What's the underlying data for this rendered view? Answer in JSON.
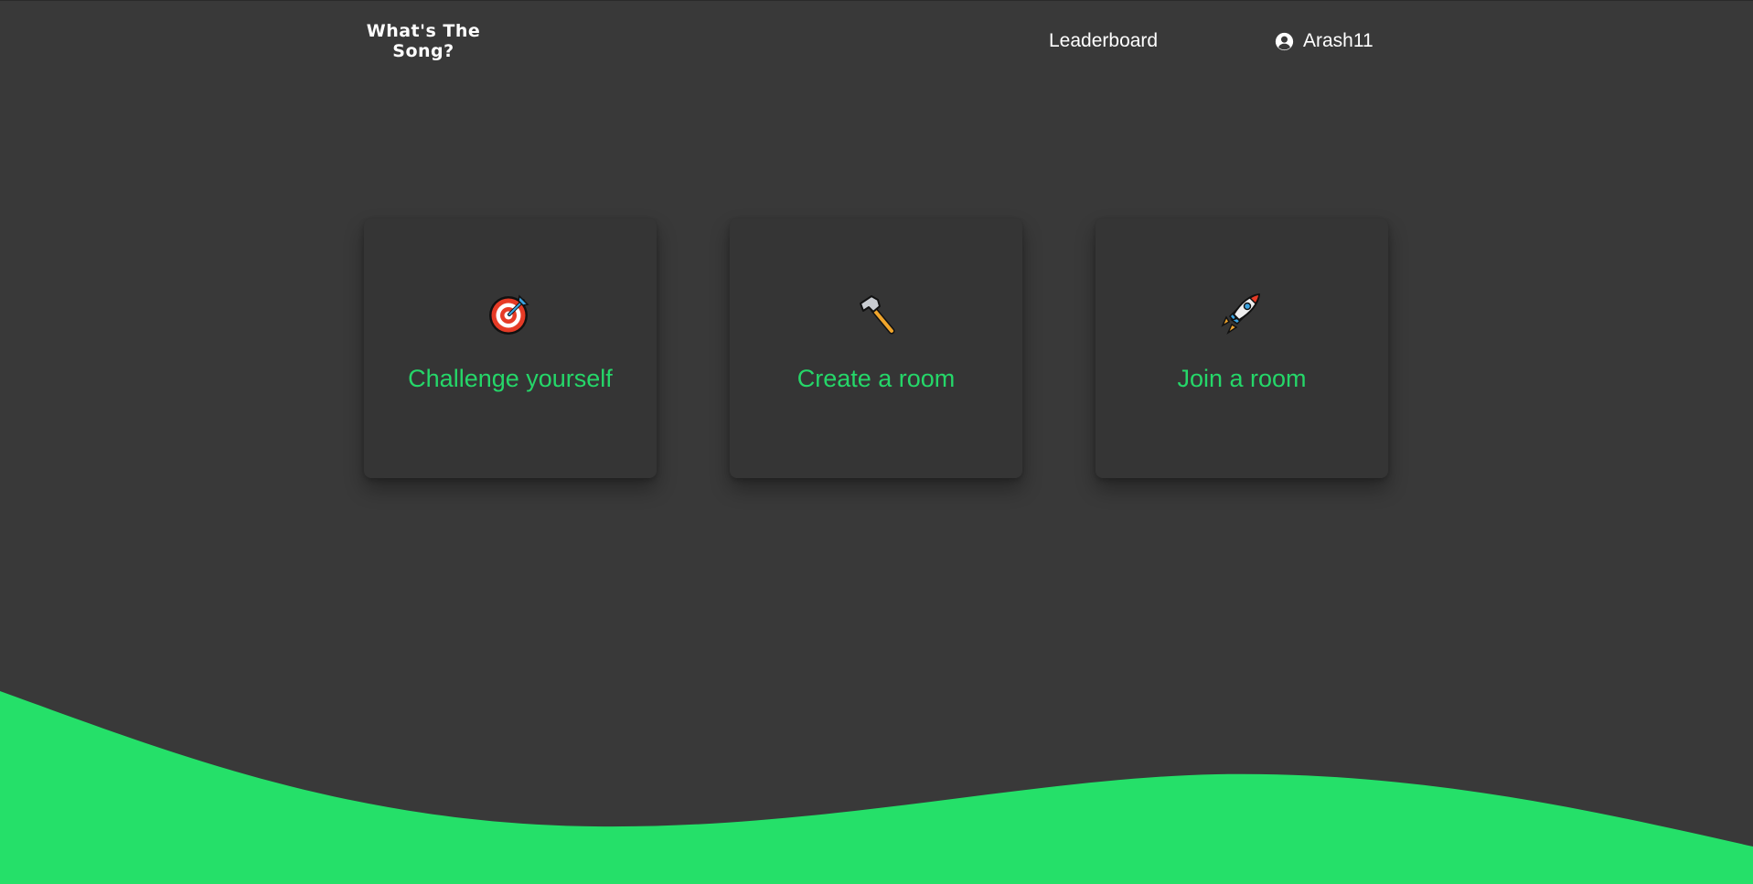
{
  "header": {
    "logo_line1": "What's The",
    "logo_line2": "Song?",
    "nav_leaderboard": "Leaderboard",
    "username": "Arash11",
    "user_icon": "user-circle-icon"
  },
  "cards": [
    {
      "label": "Challenge yourself",
      "icon": "target-dart-icon"
    },
    {
      "label": "Create a room",
      "icon": "hammer-icon"
    },
    {
      "label": "Join a room",
      "icon": "rocket-icon"
    }
  ],
  "colors": {
    "background": "#393939",
    "card": "#353535",
    "accent": "#25d769",
    "text": "#ffffff"
  }
}
